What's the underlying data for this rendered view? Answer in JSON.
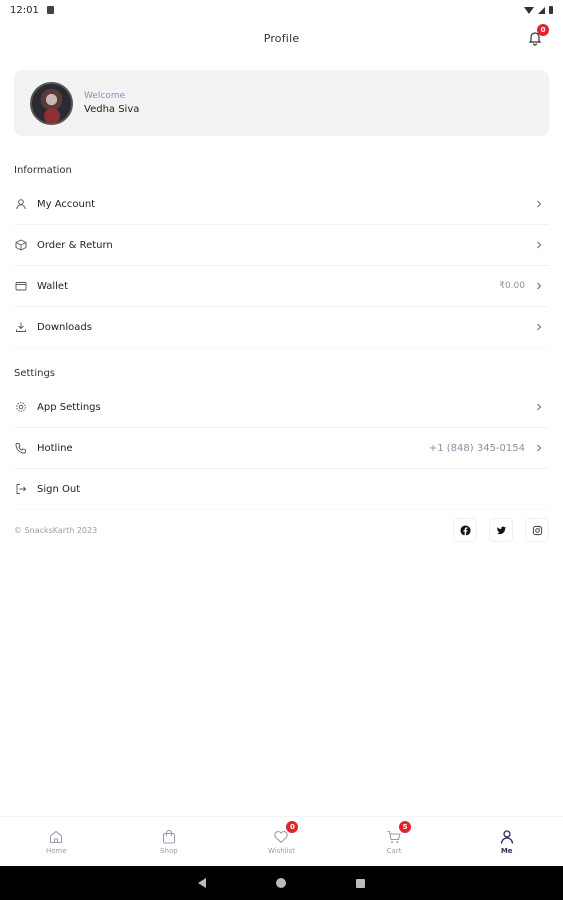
{
  "status_bar": {
    "time": "12:01",
    "icons": [
      "sd-card-icon",
      "wifi-icon",
      "signal-icon",
      "battery-icon"
    ]
  },
  "app_bar": {
    "title": "Profile",
    "notification_count": "0"
  },
  "welcome": {
    "label": "Welcome",
    "name": "Vedha Siva"
  },
  "information": {
    "title": "Information",
    "items": [
      {
        "label": "My Account",
        "icon": "user-icon",
        "value": ""
      },
      {
        "label": "Order & Return",
        "icon": "box-icon",
        "value": ""
      },
      {
        "label": "Wallet",
        "icon": "wallet-icon",
        "value": "₹0.00"
      },
      {
        "label": "Downloads",
        "icon": "download-icon",
        "value": ""
      }
    ]
  },
  "settings": {
    "title": "Settings",
    "items": [
      {
        "label": "App Settings",
        "icon": "gear-icon",
        "value": ""
      },
      {
        "label": "Hotline",
        "icon": "phone-icon",
        "value": "+1 (848) 345-0154"
      },
      {
        "label": "Sign Out",
        "icon": "sign-out-icon",
        "value": ""
      }
    ]
  },
  "footer": {
    "copyright": "© SnacksKarth 2023",
    "socials": [
      "facebook-icon",
      "twitter-icon",
      "instagram-icon"
    ]
  },
  "bottom_nav": {
    "items": [
      {
        "label": "Home",
        "icon": "home-icon",
        "badge": ""
      },
      {
        "label": "Shop",
        "icon": "shopping-bag-icon",
        "badge": ""
      },
      {
        "label": "Wishlist",
        "icon": "heart-icon",
        "badge": "0"
      },
      {
        "label": "Cart",
        "icon": "cart-icon",
        "badge": "5"
      },
      {
        "label": "Me",
        "icon": "user-icon",
        "badge": ""
      }
    ],
    "active": "Me"
  },
  "colors": {
    "accent": "#2d2f5c",
    "badge": "#e0242e",
    "muted": "#8a90a8",
    "card": "#f3f3f4"
  }
}
